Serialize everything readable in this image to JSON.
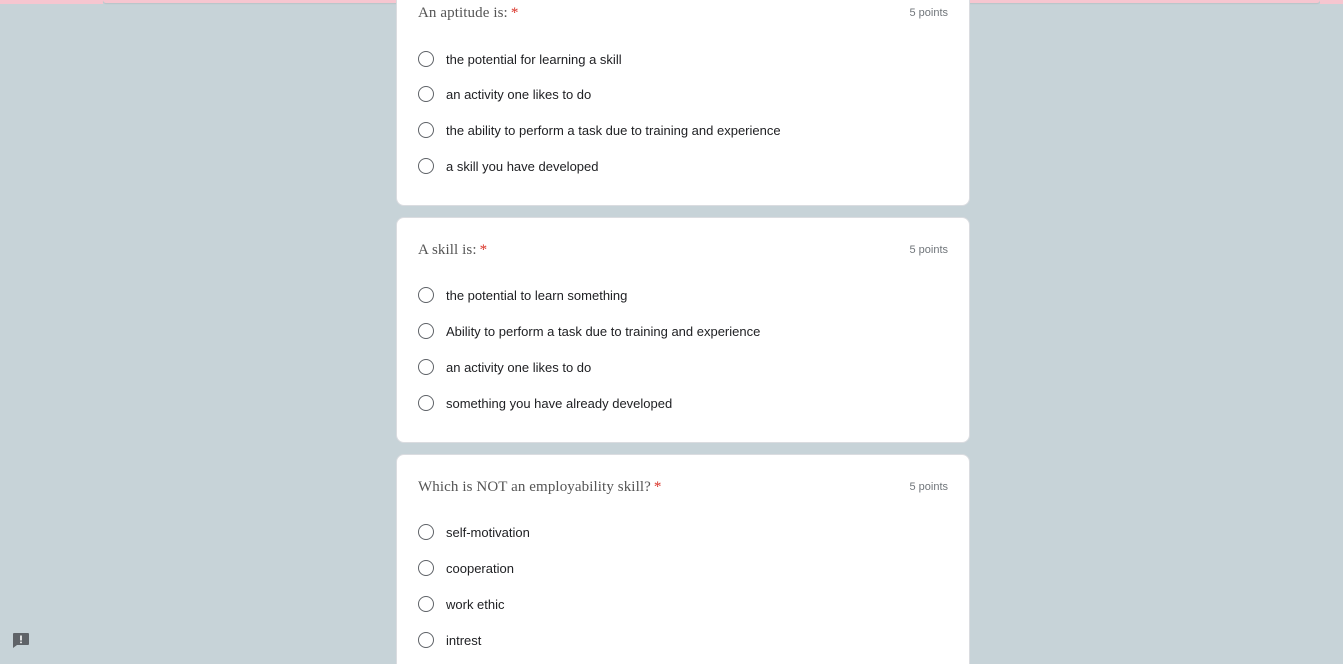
{
  "colors": {
    "background": "#c7d3d8",
    "card": "#ffffff",
    "required_star": "#d93025",
    "header_accent": "#f6c6d0"
  },
  "questions": [
    {
      "title": "An aptitude is:",
      "required_mark": "*",
      "points": "5 points",
      "options": [
        "the potential for learning a skill",
        "an activity one likes to do",
        "the ability to perform a task due to training and experience",
        "a skill you have developed"
      ]
    },
    {
      "title": "A skill is:",
      "required_mark": "*",
      "points": "5 points",
      "options": [
        "the potential to learn something",
        "Ability to perform a task due to training and experience",
        "an activity one likes to do",
        "something you have already developed"
      ]
    },
    {
      "title": "Which is NOT an employability skill?",
      "required_mark": "*",
      "points": "5 points",
      "options": [
        "self-motivation",
        "cooperation",
        "work ethic",
        "intrest"
      ]
    }
  ],
  "feedback_icon": "report-feedback-icon"
}
